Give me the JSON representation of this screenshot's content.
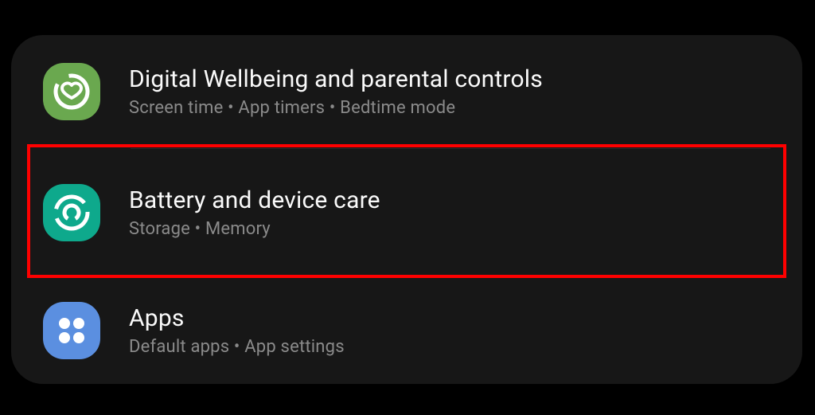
{
  "settings": {
    "items": [
      {
        "title": "Digital Wellbeing and parental controls",
        "subtitle": "Screen time  •  App timers  •  Bedtime mode",
        "icon": "wellbeing-icon",
        "icon_bg": "#6aa84f"
      },
      {
        "title": "Battery and device care",
        "subtitle": "Storage  •  Memory",
        "icon": "device-care-icon",
        "icon_bg": "#0ea98c"
      },
      {
        "title": "Apps",
        "subtitle": "Default apps  •  App settings",
        "icon": "apps-icon",
        "icon_bg": "#5b8fe0"
      }
    ]
  },
  "highlighted_index": 1
}
